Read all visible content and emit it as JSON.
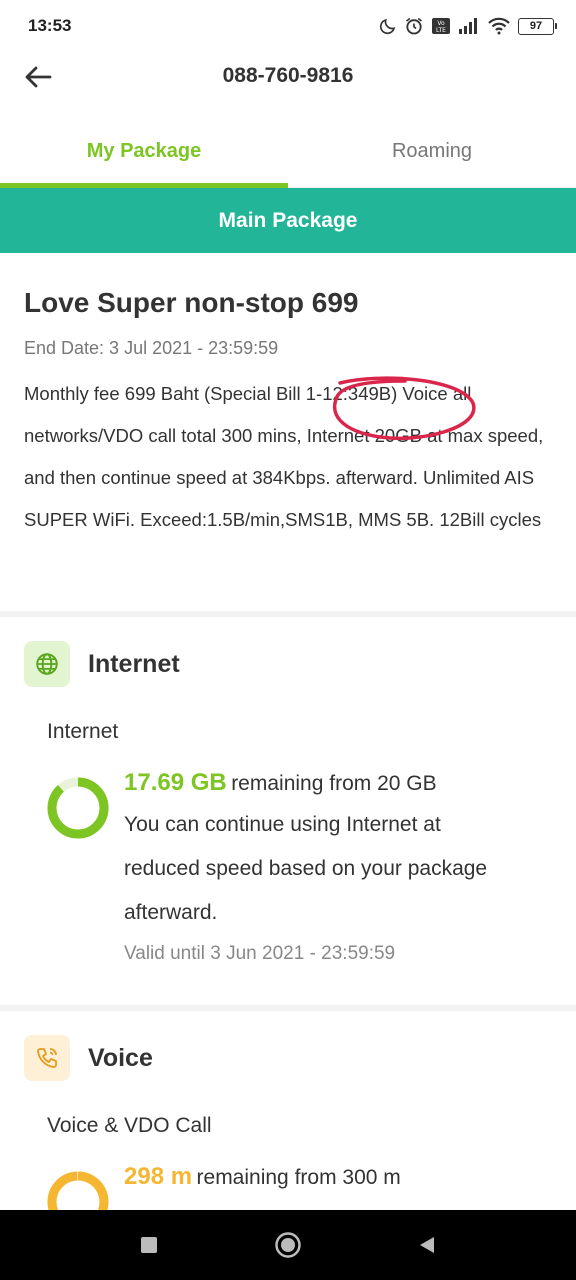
{
  "status_bar": {
    "time": "13:53",
    "battery": "97",
    "icons": [
      "moon-icon",
      "alarm-icon",
      "volte-icon",
      "signal-icon",
      "wifi-icon",
      "battery-icon"
    ]
  },
  "header": {
    "title": "088-760-9816",
    "back_icon": "arrow-left-icon"
  },
  "tabs": [
    {
      "label": "My Package",
      "active": true
    },
    {
      "label": "Roaming",
      "active": false
    }
  ],
  "banner": {
    "label": "Main Package"
  },
  "package": {
    "name": "Love Super non-stop 699",
    "end_date": "End Date: 3 Jul 2021 - 23:59:59",
    "description": "Monthly fee 699 Baht (Special Bill 1-12:349B) Voice all networks/VDO call total 300 mins, Internet 20GB at max speed, and then continue speed at 384Kbps. afterward. Unlimited AIS SUPER WiFi. Exceed:1.5B/min,SMS1B, MMS 5B. 12Bill cycles"
  },
  "internet": {
    "title": "Internet",
    "icon": "globe-icon",
    "sub_label": "Internet",
    "remaining_value": "17.69 GB",
    "remaining_text": "remaining from 20 GB",
    "remaining_fraction": 0.8845,
    "note_line1": "You can continue using Internet at",
    "note_line2": "reduced speed based on your package",
    "note_line3": "afterward.",
    "valid": "Valid until 3 Jun 2021 - 23:59:59"
  },
  "voice": {
    "title": "Voice",
    "icon": "phone-call-icon",
    "sub_label": "Voice & VDO Call",
    "remaining_value": "298 m",
    "remaining_text": "remaining from 300 m",
    "remaining_fraction": 0.9933
  },
  "colors": {
    "accent_green": "#7cc522",
    "banner_teal": "#23b597",
    "voice_orange": "#f5b731",
    "annotation_red": "#d9264a"
  },
  "navbar": {
    "icons": [
      "square-icon",
      "circle-home-icon",
      "triangle-back-icon"
    ]
  }
}
